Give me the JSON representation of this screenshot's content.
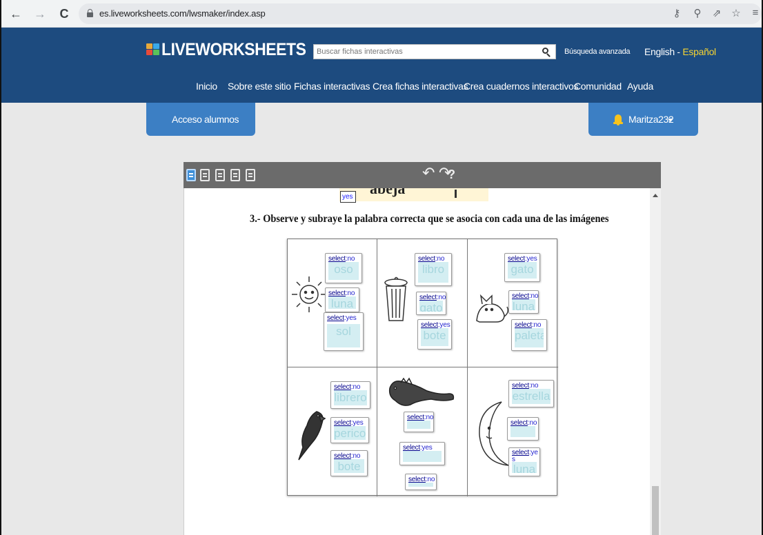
{
  "browser": {
    "url": "es.liveworksheets.com/lwsmaker/index.asp",
    "back_icon": "←",
    "forward_icon": "→",
    "reload_icon": "C"
  },
  "site": {
    "logo": "LIVEWORKSHEETS",
    "search_placeholder": "Buscar fichas interactivas",
    "advanced_search": "Búsqueda avanzada",
    "lang_en": "English",
    "lang_sep": " - ",
    "lang_es": "Español",
    "nav": [
      "Inicio",
      "Sobre este sitio",
      "Fichas interactivas",
      "Crea fichas interactivas",
      "Crea cuadernos interactivos",
      "Comunidad",
      "Ayuda"
    ],
    "student_access": "Acceso alumnos",
    "username": "Maritza232"
  },
  "editor": {
    "help": "?",
    "undo": "↶",
    "redo": "↷",
    "prev_word": "abeja",
    "prev_select": "yes",
    "question": "3.- Observe y subraye la palabra correcta que se asocia con cada una de las imágenes",
    "select_link": "select",
    "cells": [
      {
        "picture": "sun",
        "words": [
          {
            "word": "oso",
            "answer": "no"
          },
          {
            "word": "luna",
            "answer": "no"
          },
          {
            "word": "sol",
            "answer": "yes"
          }
        ]
      },
      {
        "picture": "trash-can",
        "words": [
          {
            "word": "libro",
            "answer": "no"
          },
          {
            "word": "gato",
            "answer": "no"
          },
          {
            "word": "bote",
            "answer": "yes"
          }
        ]
      },
      {
        "picture": "cat",
        "words": [
          {
            "word": "gato",
            "answer": "yes"
          },
          {
            "word": "luna",
            "answer": "no"
          },
          {
            "word": "paleta",
            "answer": "no"
          }
        ]
      },
      {
        "picture": "parrot",
        "words": [
          {
            "word": "librero",
            "answer": "no"
          },
          {
            "word": "perico",
            "answer": "yes"
          },
          {
            "word": "bote",
            "answer": "no"
          }
        ]
      },
      {
        "picture": "iguana",
        "words": [
          {
            "word": "",
            "answer": "no"
          },
          {
            "word": "",
            "answer": "yes"
          },
          {
            "word": "",
            "answer": "no"
          }
        ]
      },
      {
        "picture": "moon",
        "words": [
          {
            "word": "estrella",
            "answer": "no"
          },
          {
            "word": "",
            "answer": "no"
          },
          {
            "word": "luna",
            "answer": "ye s"
          }
        ]
      }
    ]
  }
}
